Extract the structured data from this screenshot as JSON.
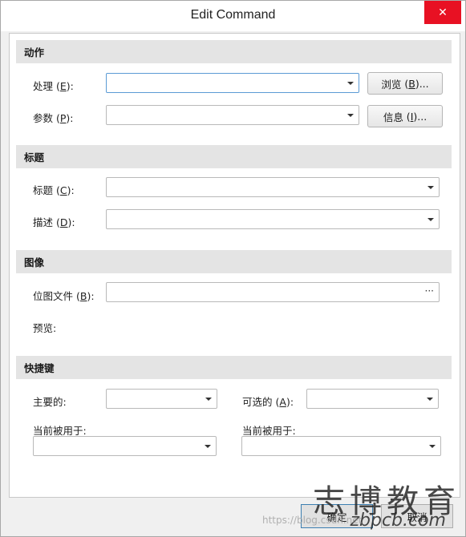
{
  "window": {
    "title": "Edit Command",
    "close_glyph": "✕"
  },
  "sections": {
    "action": "动作",
    "title": "标题",
    "image": "图像",
    "shortcut": "快捷键"
  },
  "action": {
    "handler_label": "处理",
    "handler_key": "E",
    "handler_value": "",
    "params_label": "参数",
    "params_key": "P",
    "params_value": "",
    "browse_label": "浏览",
    "browse_key": "B",
    "info_label": "信息",
    "info_key": "I"
  },
  "title_section": {
    "title_label": "标题",
    "title_key": "C",
    "title_value": "",
    "desc_label": "描述",
    "desc_key": "D",
    "desc_value": ""
  },
  "image": {
    "bitmap_label": "位图文件",
    "bitmap_key": "B",
    "bitmap_value": "",
    "bitmap_button": "···",
    "preview_label": "预览:"
  },
  "shortcut": {
    "primary_label": "主要的:",
    "alternate_label": "可选的",
    "alternate_key": "A",
    "used_by_label_1": "当前被用于:",
    "used_by_label_2": "当前被用于:"
  },
  "footer": {
    "ok_label": "确定",
    "cancel_label": "取消"
  },
  "watermark": {
    "brand": "志博教育",
    "site": "zbpcb.com",
    "blog": "https://blog.csdn.net"
  }
}
